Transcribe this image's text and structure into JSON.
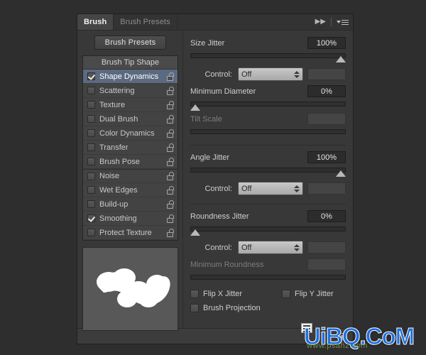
{
  "panel": {
    "tabs": [
      {
        "label": "Brush",
        "active": true
      },
      {
        "label": "Brush Presets",
        "active": false
      }
    ],
    "collapse_icon": "double-chevron-right-icon",
    "menu_icon": "panel-menu-icon"
  },
  "left": {
    "presets_button": "Brush Presets",
    "list_header": "Brush Tip Shape",
    "options": [
      {
        "label": "Shape Dynamics",
        "checked": true,
        "selected": true,
        "group_start": false
      },
      {
        "label": "Scattering",
        "checked": false,
        "selected": false,
        "group_start": false
      },
      {
        "label": "Texture",
        "checked": false,
        "selected": false,
        "group_start": false
      },
      {
        "label": "Dual Brush",
        "checked": false,
        "selected": false,
        "group_start": false
      },
      {
        "label": "Color Dynamics",
        "checked": false,
        "selected": false,
        "group_start": false
      },
      {
        "label": "Transfer",
        "checked": false,
        "selected": false,
        "group_start": false
      },
      {
        "label": "Brush Pose",
        "checked": false,
        "selected": false,
        "group_start": false
      },
      {
        "label": "Noise",
        "checked": false,
        "selected": false,
        "group_start": true
      },
      {
        "label": "Wet Edges",
        "checked": false,
        "selected": false,
        "group_start": false
      },
      {
        "label": "Build-up",
        "checked": false,
        "selected": false,
        "group_start": false
      },
      {
        "label": "Smoothing",
        "checked": true,
        "selected": false,
        "group_start": false
      },
      {
        "label": "Protect Texture",
        "checked": false,
        "selected": false,
        "group_start": false
      }
    ],
    "lock_icon": "unlocked-padlock-icon",
    "preview_name": "brush-stroke-preview"
  },
  "right": {
    "size_jitter": {
      "label": "Size Jitter",
      "value": "100%",
      "slider_pct": 100,
      "disabled": false
    },
    "size_control": {
      "label": "Control:",
      "value": "Off",
      "extra_value": ""
    },
    "minimum_diameter": {
      "label": "Minimum Diameter",
      "value": "0%",
      "slider_pct": 0,
      "disabled": false
    },
    "tilt_scale": {
      "label": "Tilt Scale",
      "value": "",
      "slider_pct": -1,
      "disabled": true
    },
    "angle_jitter": {
      "label": "Angle Jitter",
      "value": "100%",
      "slider_pct": 100,
      "disabled": false
    },
    "angle_control": {
      "label": "Control:",
      "value": "Off",
      "extra_value": ""
    },
    "roundness_jitter": {
      "label": "Roundness Jitter",
      "value": "0%",
      "slider_pct": 0,
      "disabled": false
    },
    "roundness_control": {
      "label": "Control:",
      "value": "Off",
      "extra_value": ""
    },
    "minimum_roundness": {
      "label": "Minimum Roundness",
      "value": "",
      "slider_pct": -1,
      "disabled": true
    },
    "flip_x": {
      "label": "Flip X Jitter",
      "checked": false
    },
    "flip_y": {
      "label": "Flip Y Jitter",
      "checked": false
    },
    "brush_projection": {
      "label": "Brush Projection",
      "checked": false
    }
  },
  "footer": {
    "toggle_icon": "eye-toggle-icon"
  },
  "watermark": {
    "text": "UiBQ.CoM",
    "subtext": "www.psahz.com"
  },
  "colors": {
    "panel_bg": "#383838",
    "selection": "#5b6a80",
    "text": "#cfcfcf",
    "value_bg": "#2c2c2c",
    "watermark": "#1f6fe0"
  }
}
